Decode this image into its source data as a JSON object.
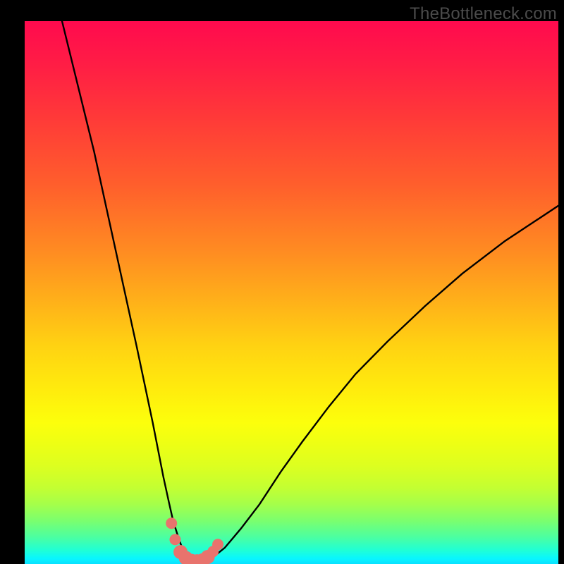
{
  "watermark": "TheBottleneck.com",
  "chart_data": {
    "type": "line",
    "title": "",
    "xlabel": "",
    "ylabel": "",
    "xlim": [
      0,
      100
    ],
    "ylim": [
      0,
      100
    ],
    "series": [
      {
        "name": "bottleneck-curve",
        "x": [
          7,
          10,
          13,
          15,
          17,
          19,
          21,
          22.5,
          24,
          25,
          26,
          27,
          27.8,
          28.6,
          29.3,
          30,
          30.8,
          31.8,
          33,
          34.2,
          35.6,
          37.5,
          40.5,
          44,
          48,
          52,
          57,
          62,
          68,
          75,
          82,
          90,
          100
        ],
        "values": [
          100,
          88,
          76,
          67,
          58,
          49,
          40,
          33,
          26,
          21,
          16,
          11.5,
          8,
          5.5,
          3.5,
          2,
          1.1,
          0.6,
          0.5,
          0.8,
          1.5,
          3,
          6.5,
          11,
          17,
          22.5,
          29,
          35,
          41,
          47.5,
          53.5,
          59.5,
          66
        ]
      }
    ],
    "markers": {
      "name": "highlight-points",
      "color": "#e8736d",
      "points": [
        {
          "x": 27.5,
          "y": 7.5,
          "r": 8
        },
        {
          "x": 28.2,
          "y": 4.5,
          "r": 8
        },
        {
          "x": 29.2,
          "y": 2.2,
          "r": 10
        },
        {
          "x": 30.2,
          "y": 1.1,
          "r": 10
        },
        {
          "x": 31.2,
          "y": 0.6,
          "r": 10
        },
        {
          "x": 32.3,
          "y": 0.5,
          "r": 10
        },
        {
          "x": 33.4,
          "y": 0.7,
          "r": 10
        },
        {
          "x": 34.3,
          "y": 1.3,
          "r": 10
        },
        {
          "x": 35.3,
          "y": 2.3,
          "r": 8
        },
        {
          "x": 36.2,
          "y": 3.6,
          "r": 8
        }
      ]
    },
    "background_gradient": {
      "top": "#ff0a4e",
      "mid": "#ffd312",
      "bottom": "#0ae0ff"
    }
  }
}
